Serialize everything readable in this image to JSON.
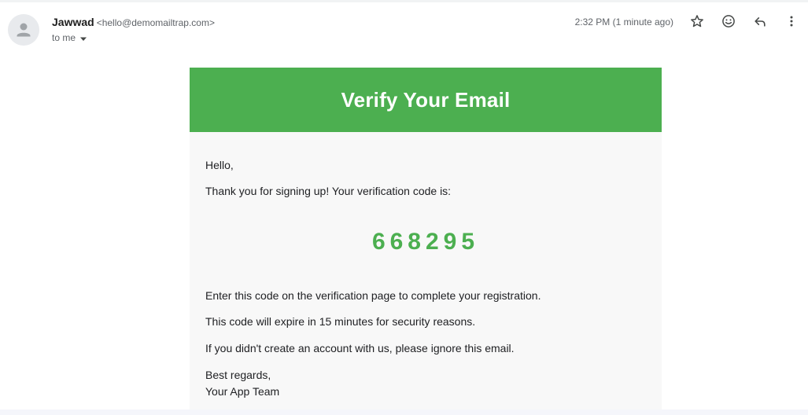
{
  "header": {
    "sender_name": "Jawwad",
    "sender_email": "<hello@demomailtrap.com>",
    "recipient": "to me",
    "timestamp": "2:32 PM (1 minute ago)",
    "icons": {
      "avatar": "default-avatar-icon",
      "star": "star-icon",
      "emoji": "emoji-reaction-icon",
      "reply": "reply-icon",
      "more": "more-vert-icon",
      "caret": "caret-down-icon"
    }
  },
  "email": {
    "title": "Verify Your Email",
    "greeting": "Hello,",
    "intro": "Thank you for signing up! Your verification code is:",
    "code": "668295",
    "instruction": "Enter this code on the verification page to complete your registration.",
    "expiry": "This code will expire in 15 minutes for security reasons.",
    "ignore_note": "If you didn't create an account with us, please ignore this email.",
    "sign_off": "Best regards,",
    "signature": "Your App Team"
  },
  "colors": {
    "brand_green": "#4caf50",
    "card_background": "#f8f8f8",
    "meta_text": "#5f6368"
  }
}
